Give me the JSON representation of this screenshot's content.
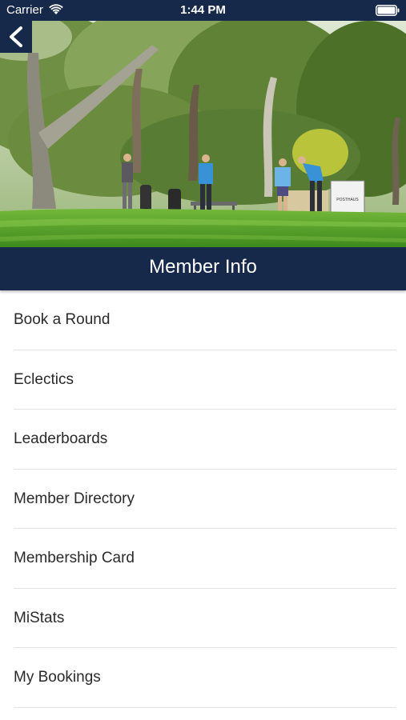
{
  "status_bar": {
    "carrier": "Carrier",
    "time": "1:44 PM"
  },
  "header": {
    "title": "Member Info",
    "accent_color": "#16294a"
  },
  "hero": {
    "sign_text": "POSTHAUS"
  },
  "menu": {
    "items": [
      {
        "label": "Book a Round"
      },
      {
        "label": "Eclectics"
      },
      {
        "label": "Leaderboards"
      },
      {
        "label": "Member Directory"
      },
      {
        "label": "Membership Card"
      },
      {
        "label": "MiStats"
      },
      {
        "label": "My Bookings"
      }
    ]
  }
}
